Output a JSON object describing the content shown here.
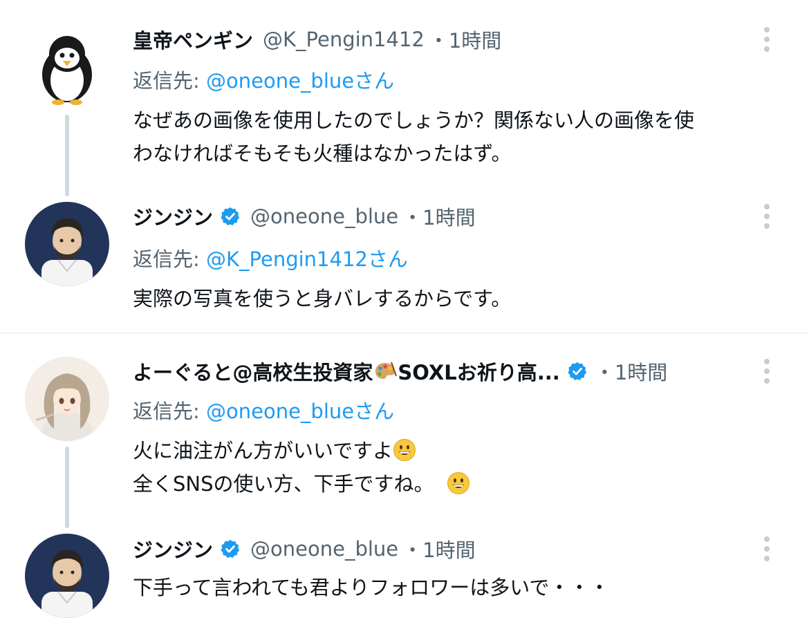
{
  "tweets": [
    {
      "display_name": "皇帝ペンギン",
      "handle": "@K_Pengin1412",
      "time": "・1時間",
      "reply_label": "返信先:",
      "reply_mention": "@oneone_blueさん",
      "lines": [
        "なぜあの画像を使用したのでしょうか？関係ない人の画像を使",
        "わなければそもそも火種はなかったはず。"
      ],
      "verified": false,
      "avatar": "penguin-avatar"
    },
    {
      "display_name": "ジンジン",
      "handle": "@oneone_blue",
      "time": "・1時間",
      "reply_label": "返信先:",
      "reply_mention": "@K_Pengin1412さん",
      "lines": [
        "実際の写真を使うと身バレするからです。"
      ],
      "verified": true,
      "avatar": "illustrated-man-avatar"
    },
    {
      "display_name": "よーぐると@高校生投資家",
      "display_name_suffix": "SOXLお祈り高...",
      "handle": "",
      "time": "・1時間",
      "reply_label": "返信先:",
      "reply_mention": "@oneone_blueさん",
      "lines": [
        "火に油注がん方がいいですよ",
        "全くSNSの使い方、下手ですね。"
      ],
      "verified": true,
      "avatar": "anime-girl-avatar"
    },
    {
      "display_name": "ジンジン",
      "handle": "@oneone_blue",
      "time": "・1時間",
      "lines": [
        "下手って言われても君よりフォロワーは多いで・・・"
      ],
      "verified": true,
      "avatar": "illustrated-man-avatar"
    }
  ],
  "colors": {
    "text": "#0f1419",
    "secondary": "#536471",
    "link": "#1d9bf0",
    "verified": "#1d9bf0",
    "thread_line": "#cfd9de",
    "divider": "#eff3f4"
  },
  "icons": {
    "verified": "verified-badge-icon",
    "more": "more-options-icon",
    "emoji": "grinning-face-emoji",
    "palette": "artist-palette-emoji"
  }
}
